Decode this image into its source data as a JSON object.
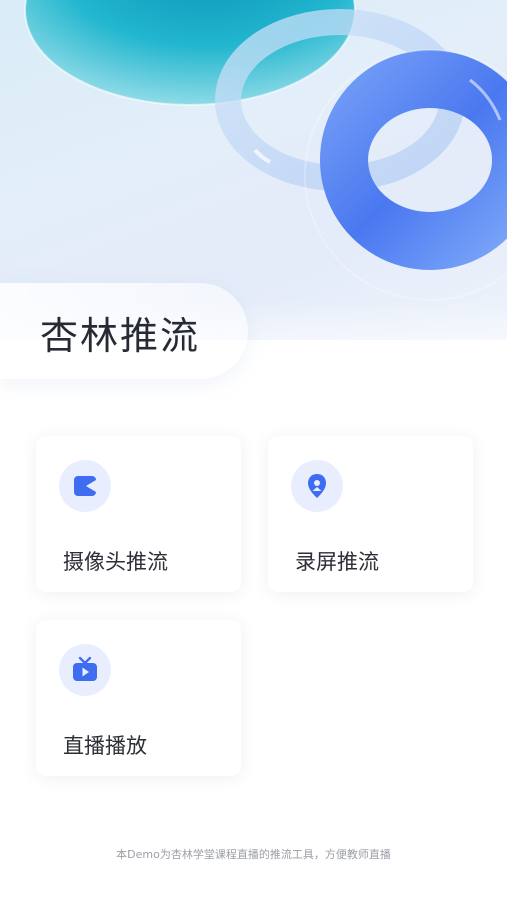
{
  "header": {
    "title": "杏林推流"
  },
  "menu": {
    "items": [
      {
        "label": "摄像头推流",
        "icon": "camera-icon"
      },
      {
        "label": "录屏推流",
        "icon": "screen-record-icon"
      },
      {
        "label": "直播播放",
        "icon": "tv-play-icon"
      }
    ]
  },
  "footer": {
    "text": "本Demo为杏林学堂课程直播的推流工具，方便教师直播"
  },
  "colors": {
    "accent": "#3f6df2",
    "icon_bg": "#e9eeff",
    "title": "#262a33",
    "footer": "#9a9ea6"
  }
}
